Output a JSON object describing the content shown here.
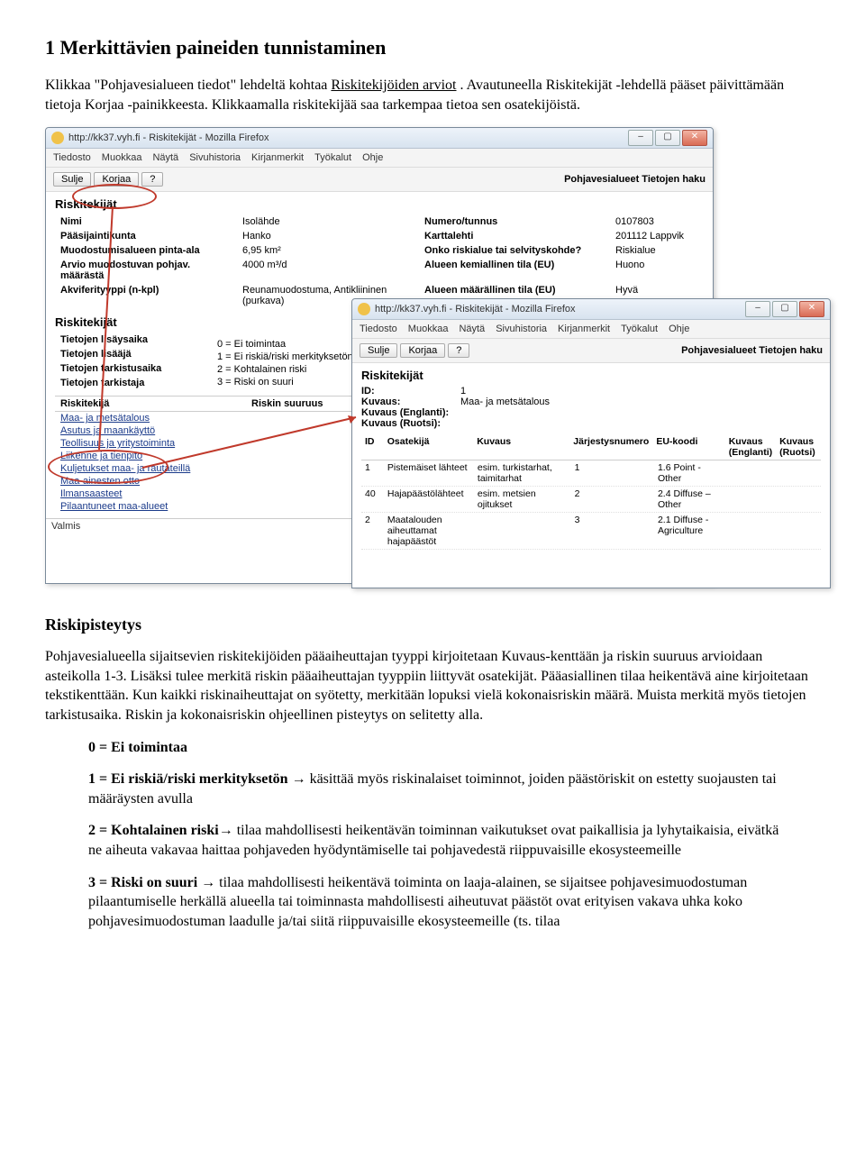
{
  "doc": {
    "h1": "1 Merkittävien paineiden tunnistaminen",
    "p1a": "Klikkaa \"Pohjavesialueen tiedot\" lehdeltä kohtaa ",
    "p1_link": "Riskitekijöiden arviot",
    "p1b": ". Avautuneella Riskitekijät -lehdellä pääset päivittämään tietoja Korjaa -painikkeesta. Klikkaamalla riskitekijää saa tarkempaa tietoa sen osatekijöistä.",
    "h2": "Riskipisteytys",
    "p2": "Pohjavesialueella sijaitsevien riskitekijöiden pääaiheuttajan tyyppi kirjoitetaan Kuvaus-kenttään ja riskin suuruus arvioidaan asteikolla 1-3. Lisäksi tulee merkitä riskin pääaiheuttajan tyyppiin liittyvät osatekijät. Pääasiallinen tilaa heikentävä aine kirjoitetaan tekstikenttään. Kun kaikki riskinaiheuttajat on syötetty, merkitään lopuksi vielä kokonaisriskin määrä. Muista merkitä myös tietojen tarkistusaika. Riskin ja kokonaisriskin ohjeellinen pisteytys on selitetty alla.",
    "scale": {
      "s0": "0 = Ei toimintaa",
      "s1a": "1 = Ei riskiä/riski merkityksetön ",
      "s1b": " käsittää myös riskinalaiset toiminnot, joiden päästöriskit on estetty suojausten tai määräysten avulla",
      "s2a": "2 = Kohtalainen riski",
      "s2b": " tilaa mahdollisesti heikentävän toiminnan vaikutukset ovat paikallisia ja lyhytaikaisia, eivätkä ne aiheuta vakavaa haittaa pohjaveden hyödyntämiselle tai pohjavedestä riippuvaisille ekosysteemeille",
      "s3a": "3 = Riski on suuri ",
      "s3b": " tilaa mahdollisesti heikentävä toiminta on laaja-alainen, se sijaitsee pohjavesimuodostuman pilaantumiselle herkällä alueella tai toiminnasta mahdollisesti aiheutuvat päästöt ovat erityisen vakava uhka koko pohjavesimuodostuman laadulle ja/tai siitä riippuvaisille ekosysteemeille (ts. tilaa"
    }
  },
  "win1": {
    "title": "http://kk37.vyh.fi - Riskitekijät - Mozilla Firefox",
    "menus": [
      "Tiedosto",
      "Muokkaa",
      "Näytä",
      "Sivuhistoria",
      "Kirjanmerkit",
      "Työkalut",
      "Ohje"
    ],
    "tbtn_close": "Sulje",
    "tbtn_edit": "Korjaa",
    "tbtn_q": "?",
    "right": "Pohjavesialueet Tietojen haku",
    "section": "Riskitekijät",
    "rows": [
      {
        "l": "Nimi",
        "v": "Isolähde",
        "l2": "Numero/tunnus",
        "v2": "0107803"
      },
      {
        "l": "Pääsijaintikunta",
        "v": "Hanko",
        "l2": "Karttalehti",
        "v2": "201112 Lappvik"
      },
      {
        "l": "Muodostumisalueen pinta-ala",
        "v": "6,95 km²",
        "l2": "Onko riskialue tai selvityskohde?",
        "v2": "Riskialue"
      },
      {
        "l": "Arvio muodostuvan pohjav. määrästä",
        "v": "4000 m³/d",
        "l2": "Alueen kemiallinen tila (EU)",
        "v2": "Huono"
      },
      {
        "l": "Akviferityyppi (n-kpl)",
        "v": "Reunamuodostuma, Antikliininen (purkava)",
        "l2": "Alueen määrällinen tila (EU)",
        "v2": "Hyvä"
      }
    ],
    "sub_section": "Riskitekijät",
    "meta_labels": {
      "a": "Tietojen lisäysaika",
      "b": "Tietojen lisääjä",
      "c": "Tietojen tarkistusaika",
      "d": "Tietojen tarkistaja"
    },
    "scale": [
      "0 = Ei toimintaa",
      "1 = Ei riskiä/riski merkityksetön",
      "2 = Kohtalainen riski",
      "3 = Riski on suuri"
    ],
    "table_head": {
      "a": "Riskitekijä",
      "b": "Riskin suuruus"
    },
    "risk_links": [
      "Maa- ja metsätalous",
      "Asutus ja maankäyttö",
      "Teollisuus ja yritystoiminta",
      "Liikenne ja tienpito",
      "Kuljetukset maa- ja rautateillä",
      "Maa-ainesten otto",
      "Ilmansaasteet",
      "Pilaantuneet maa-alueet"
    ],
    "status": "Valmis"
  },
  "win2": {
    "title": "http://kk37.vyh.fi - Riskitekijät - Mozilla Firefox",
    "menus": [
      "Tiedosto",
      "Muokkaa",
      "Näytä",
      "Sivuhistoria",
      "Kirjanmerkit",
      "Työkalut",
      "Ohje"
    ],
    "tbtn_close": "Sulje",
    "tbtn_edit": "Korjaa",
    "tbtn_q": "?",
    "right": "Pohjavesialueet Tietojen haku",
    "section": "Riskitekijät",
    "kv": [
      {
        "k": "ID:",
        "v": "1"
      },
      {
        "k": "Kuvaus:",
        "v": "Maa- ja metsätalous"
      },
      {
        "k": "Kuvaus (Englanti):",
        "v": ""
      },
      {
        "k": "Kuvaus (Ruotsi):",
        "v": ""
      }
    ],
    "osa_head": {
      "c1": "ID",
      "c2": "Osatekijä",
      "c3": "Kuvaus",
      "c4": "Järjestysnumero",
      "c5": "EU-koodi",
      "c6": "Kuvaus (Englanti)",
      "c7": "Kuvaus (Ruotsi)"
    },
    "osa_rows": [
      {
        "c1": "1",
        "c2": "Pistemäiset lähteet",
        "c3": "esim. turkistarhat, taimitarhat",
        "c4": "1",
        "c5": "1.6 Point - Other",
        "c6": "",
        "c7": ""
      },
      {
        "c1": "40",
        "c2": "Hajapäästölähteet",
        "c3": "esim. metsien ojitukset",
        "c4": "2",
        "c5": "2.4 Diffuse –Other",
        "c6": "",
        "c7": ""
      },
      {
        "c1": "2",
        "c2": "Maatalouden aiheuttamat hajapäästöt",
        "c3": "",
        "c4": "3",
        "c5": "2.1 Diffuse - Agriculture",
        "c6": "",
        "c7": ""
      }
    ]
  }
}
